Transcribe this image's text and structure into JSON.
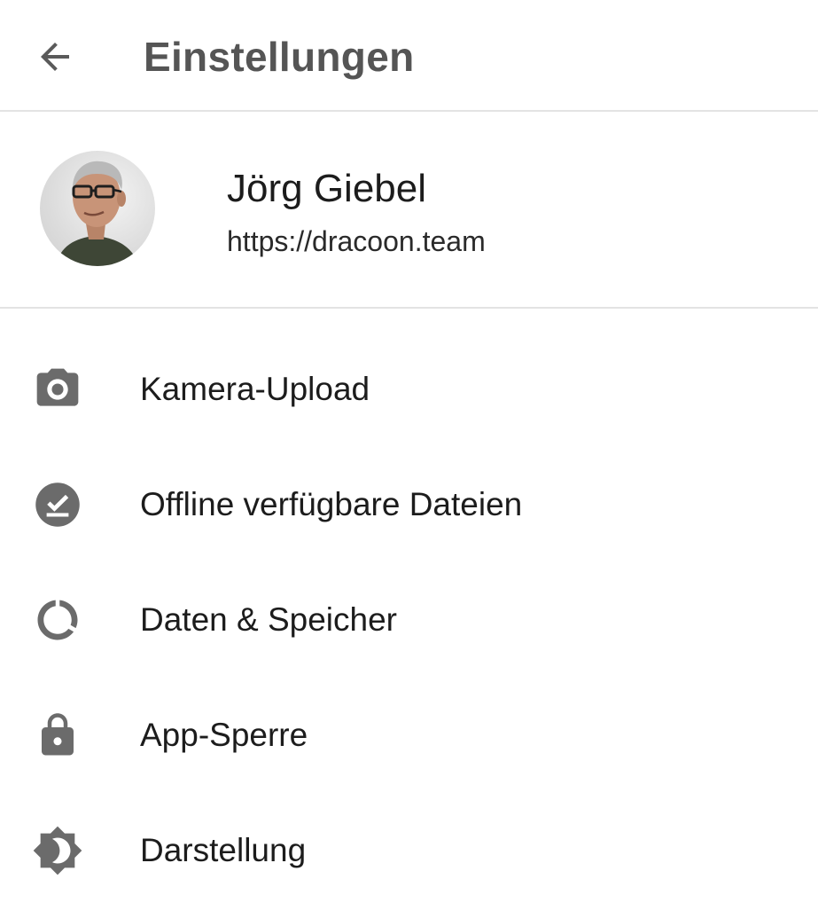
{
  "appbar": {
    "title": "Einstellungen",
    "back_icon": "arrow-back-icon"
  },
  "profile": {
    "name": "Jörg Giebel",
    "server_url": "https://dracoon.team",
    "avatar": "user-avatar-photo"
  },
  "menu": {
    "items": [
      {
        "label": "Kamera-Upload",
        "icon": "camera-icon"
      },
      {
        "label": "Offline verfügbare Dateien",
        "icon": "offline-check-icon"
      },
      {
        "label": "Daten & Speicher",
        "icon": "data-usage-icon"
      },
      {
        "label": "App-Sperre",
        "icon": "lock-icon"
      },
      {
        "label": "Darstellung",
        "icon": "brightness-icon"
      }
    ]
  },
  "colors": {
    "icon_gray": "#6b6b6b",
    "title_gray": "#555555",
    "text_dark": "#1c1c1c",
    "divider": "#e3e3e3"
  }
}
